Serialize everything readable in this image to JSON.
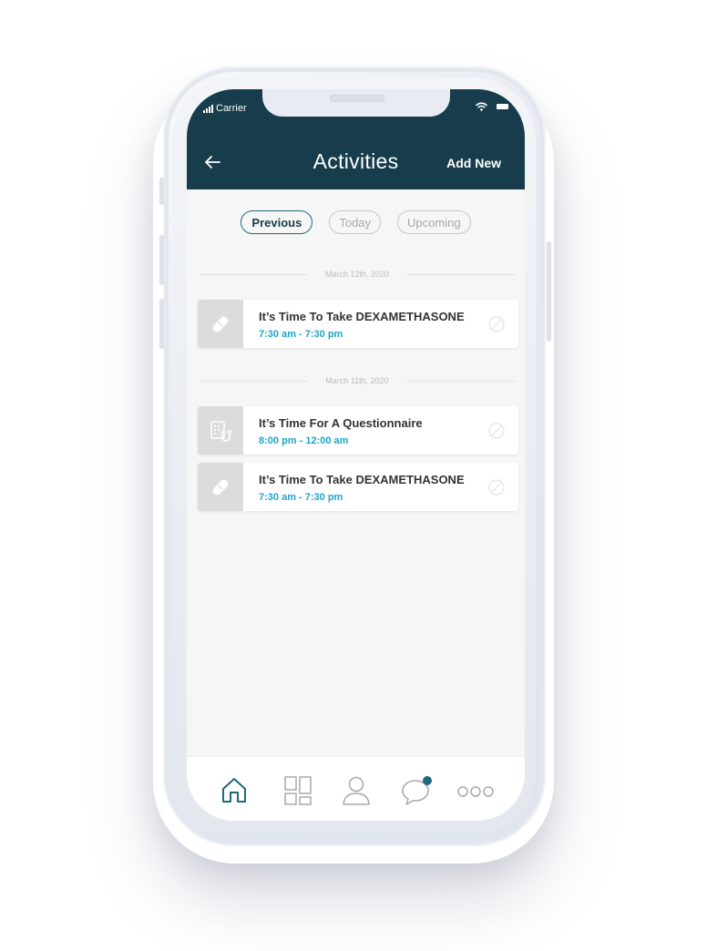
{
  "status_bar": {
    "carrier": "Carrier"
  },
  "header": {
    "title": "Activities",
    "add_new_label": "Add New"
  },
  "filters": [
    {
      "label": "Previous",
      "active": true
    },
    {
      "label": "Today",
      "active": false
    },
    {
      "label": "Upcoming",
      "active": false
    }
  ],
  "groups": [
    {
      "date": "March 12th, 2020",
      "items": [
        {
          "title": "It’s Time To Take DEXAMETHASONE",
          "time": "7:30 am - 7:30 pm",
          "icon": "pill-icon"
        }
      ]
    },
    {
      "date": "March 11th, 2020",
      "items": [
        {
          "title": "It’s Time For A Questionnaire",
          "time": "8:00 pm - 12:00 am",
          "icon": "questionnaire-icon"
        },
        {
          "title": "It’s Time To Take DEXAMETHASONE",
          "time": "7:30 am - 7:30 pm",
          "icon": "pill-icon"
        }
      ]
    }
  ],
  "bottom_nav": [
    {
      "icon": "home-icon",
      "active": true
    },
    {
      "icon": "dashboard-icon",
      "active": false
    },
    {
      "icon": "profile-icon",
      "active": false
    },
    {
      "icon": "chat-icon",
      "active": false,
      "notification": true
    },
    {
      "icon": "more-icon",
      "active": false
    }
  ],
  "colors": {
    "header_bg": "#173d4c",
    "accent_teal": "#1f6a7d",
    "time_blue": "#1ea4c9",
    "screen_bg": "#f6f6f6",
    "thumb_bg": "#dcdcdc"
  }
}
